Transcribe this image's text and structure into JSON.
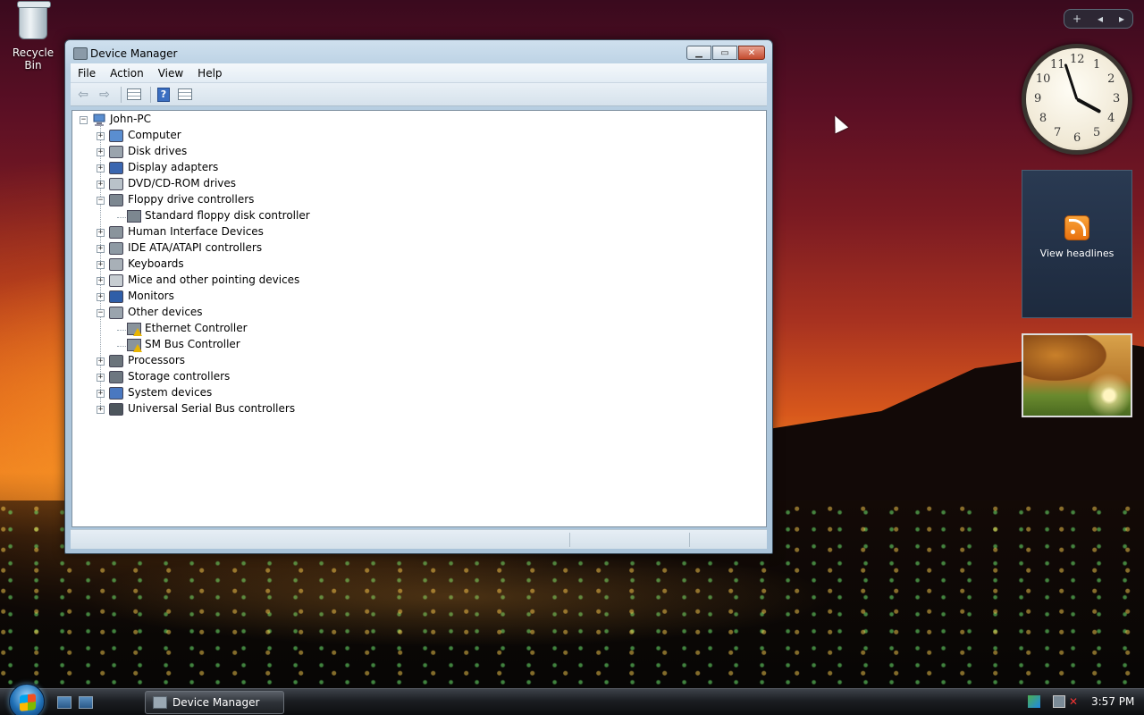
{
  "desktop": {
    "recycle_bin_label": "Recycle Bin"
  },
  "window": {
    "title": "Device Manager",
    "menu": [
      "File",
      "Action",
      "View",
      "Help"
    ],
    "toolbar_icons": [
      "back-arrow-icon",
      "forward-arrow-icon",
      "properties-icon",
      "help-icon",
      "console-tree-icon"
    ]
  },
  "tree": {
    "root": "John-PC",
    "items": [
      {
        "label": "Computer",
        "icon": "computer-icon",
        "expanded": false
      },
      {
        "label": "Disk drives",
        "icon": "disk-drive-icon",
        "expanded": false
      },
      {
        "label": "Display adapters",
        "icon": "display-adapter-icon",
        "expanded": false
      },
      {
        "label": "DVD/CD-ROM drives",
        "icon": "optical-drive-icon",
        "expanded": false
      },
      {
        "label": "Floppy drive controllers",
        "icon": "floppy-controller-icon",
        "expanded": true,
        "children": [
          {
            "label": "Standard floppy disk controller",
            "icon": "floppy-controller-icon",
            "warning": false
          }
        ]
      },
      {
        "label": "Human Interface Devices",
        "icon": "hid-icon",
        "expanded": false
      },
      {
        "label": "IDE ATA/ATAPI controllers",
        "icon": "ide-controller-icon",
        "expanded": false
      },
      {
        "label": "Keyboards",
        "icon": "keyboard-icon",
        "expanded": false
      },
      {
        "label": "Mice and other pointing devices",
        "icon": "mouse-icon",
        "expanded": false
      },
      {
        "label": "Monitors",
        "icon": "monitor-icon",
        "expanded": false
      },
      {
        "label": "Other devices",
        "icon": "unknown-device-icon",
        "expanded": true,
        "children": [
          {
            "label": "Ethernet Controller",
            "icon": "warning-device-icon",
            "warning": true
          },
          {
            "label": "SM Bus Controller",
            "icon": "warning-device-icon",
            "warning": true
          }
        ]
      },
      {
        "label": "Processors",
        "icon": "processor-icon",
        "expanded": false
      },
      {
        "label": "Storage controllers",
        "icon": "storage-controller-icon",
        "expanded": false
      },
      {
        "label": "System devices",
        "icon": "system-device-icon",
        "expanded": false
      },
      {
        "label": "Universal Serial Bus controllers",
        "icon": "usb-icon",
        "expanded": false
      }
    ]
  },
  "sidebar": {
    "controls": [
      "+",
      "◂",
      "▸"
    ],
    "clock_numbers": [
      "12",
      "1",
      "2",
      "3",
      "4",
      "5",
      "6",
      "7",
      "8",
      "9",
      "10",
      "11"
    ],
    "clock_time": {
      "hour": 3,
      "minute": 57
    },
    "feed_label": "View headlines"
  },
  "taskbar": {
    "active_task": "Device Manager",
    "time": "3:57 PM"
  },
  "colors": {
    "window_frame": "#b8cfe2",
    "tree_background": "#ffffff",
    "taskbar": "#1b1e22",
    "close_button": "#c44b2e",
    "warning": "#e8b400"
  }
}
